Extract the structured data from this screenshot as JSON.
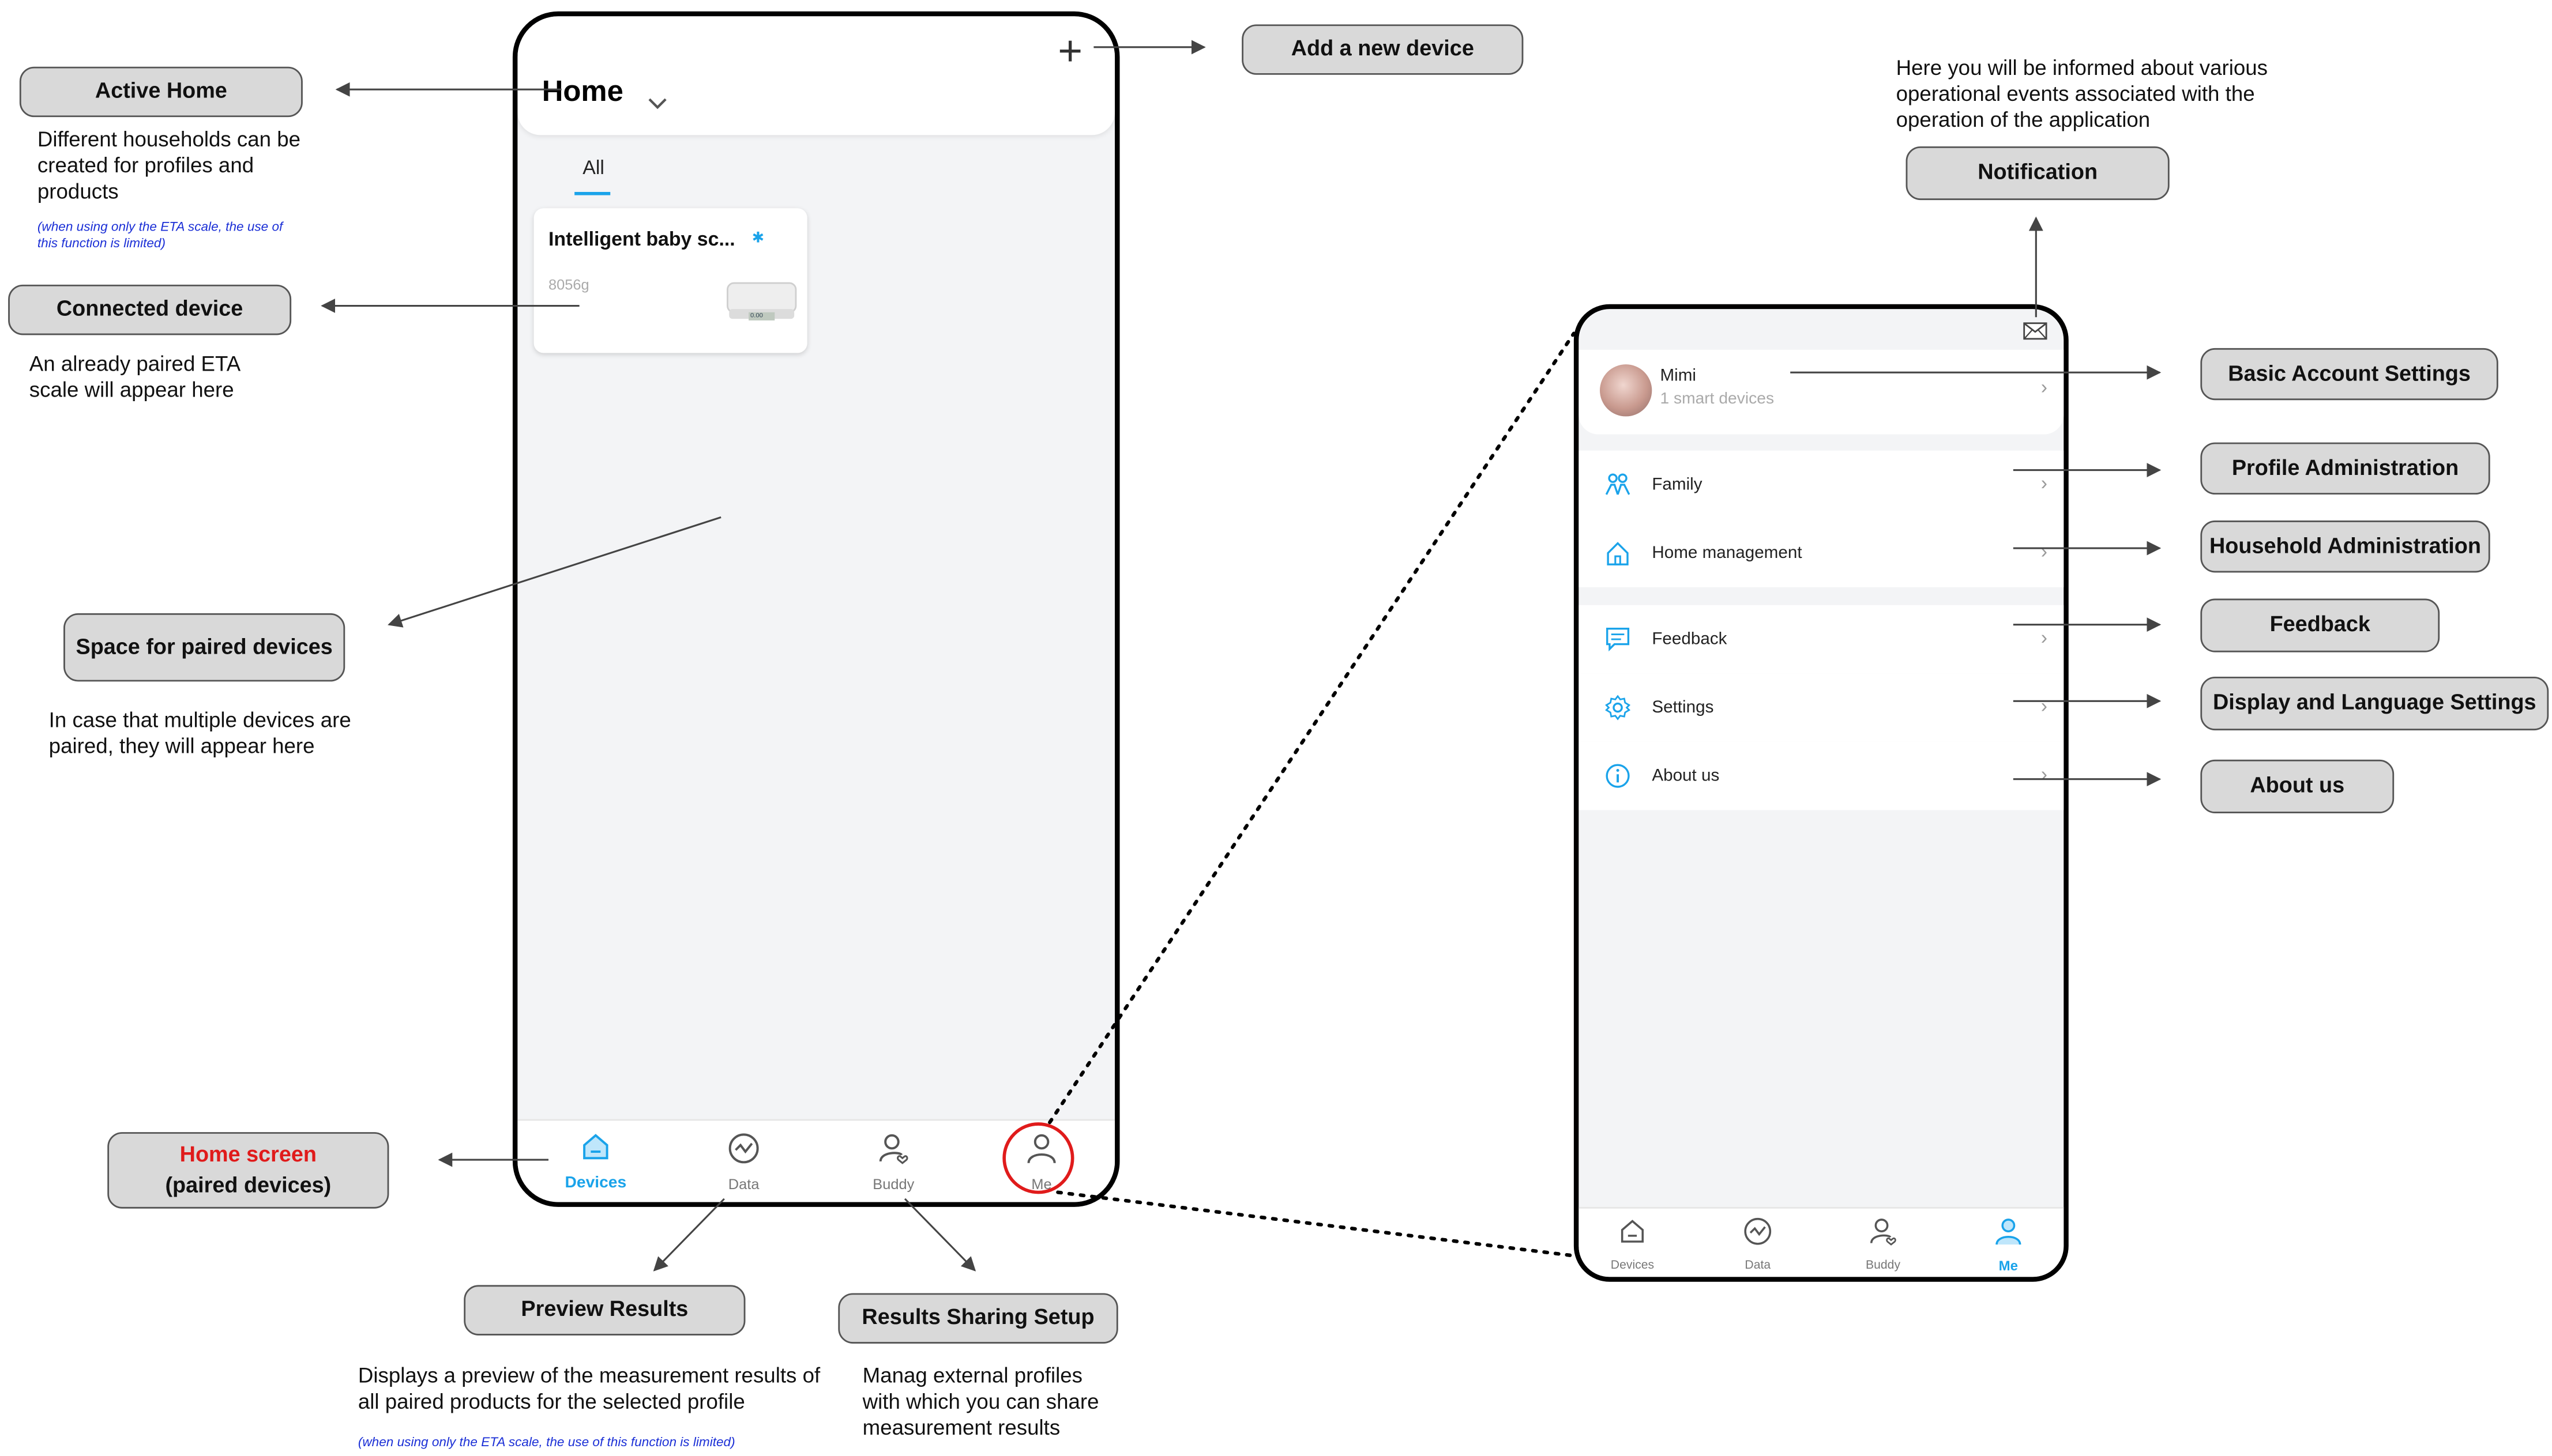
{
  "left_phone": {
    "title": "Home",
    "tab_all": "All",
    "device_card": {
      "name": "Intelligent baby sc...",
      "weight": "8056g",
      "display": "0.00"
    },
    "tabs": [
      {
        "label": "Devices",
        "icon": "home-icon",
        "active": true
      },
      {
        "label": "Data",
        "icon": "chart-icon",
        "active": false
      },
      {
        "label": "Buddy",
        "icon": "buddy-icon",
        "active": false
      },
      {
        "label": "Me",
        "icon": "user-icon",
        "active": false
      }
    ]
  },
  "right_phone": {
    "profile": {
      "name": "Mimi",
      "subtitle": "1 smart devices"
    },
    "menu": [
      {
        "label": "Family",
        "icon": "family-icon"
      },
      {
        "label": "Home management",
        "icon": "home-icon"
      },
      {
        "label": "Feedback",
        "icon": "feedback-icon"
      },
      {
        "label": "Settings",
        "icon": "gear-icon"
      },
      {
        "label": "About us",
        "icon": "info-icon"
      }
    ],
    "tabs": [
      {
        "label": "Devices",
        "icon": "home-icon",
        "active": false
      },
      {
        "label": "Data",
        "icon": "chart-icon",
        "active": false
      },
      {
        "label": "Buddy",
        "icon": "buddy-icon",
        "active": false
      },
      {
        "label": "Me",
        "icon": "user-icon",
        "active": true
      }
    ]
  },
  "callouts": {
    "active_home": "Active Home",
    "active_home_desc": "Different households can be created for profiles and products",
    "active_home_note": "(when using only the ETA scale, the use of this function is limited)",
    "connected_device": "Connected device",
    "connected_device_desc": "An already paired ETA scale will appear here",
    "space_paired": "Space for paired devices",
    "space_paired_desc": "In case that multiple devices are paired, they will appear here",
    "home_screen_line1": "Home screen",
    "home_screen_line2": "(paired devices)",
    "add_device": "Add a new device",
    "preview_results": "Preview Results",
    "preview_results_desc": "Displays a preview of the measurement results of all paired products for the selected profile",
    "preview_results_note": "(when using only the ETA scale, the use of this function is limited)",
    "sharing_setup": "Results Sharing Setup",
    "sharing_setup_desc": "Manag external profiles with which you can share measurement results",
    "notification": "Notification",
    "notification_desc": "Here you will be informed about various operational events associated with the operation of the application",
    "basic_account": "Basic Account Settings",
    "profile_admin": "Profile Administration",
    "household_admin": "Household Administration",
    "feedback": "Feedback",
    "display_language": "Display and Language Settings",
    "about_us": "About us"
  },
  "colors": {
    "accent": "#1aa3ea",
    "highlight": "#e01b1b",
    "callout_bg": "#d9d9d9",
    "note": "#1b2fd6"
  }
}
